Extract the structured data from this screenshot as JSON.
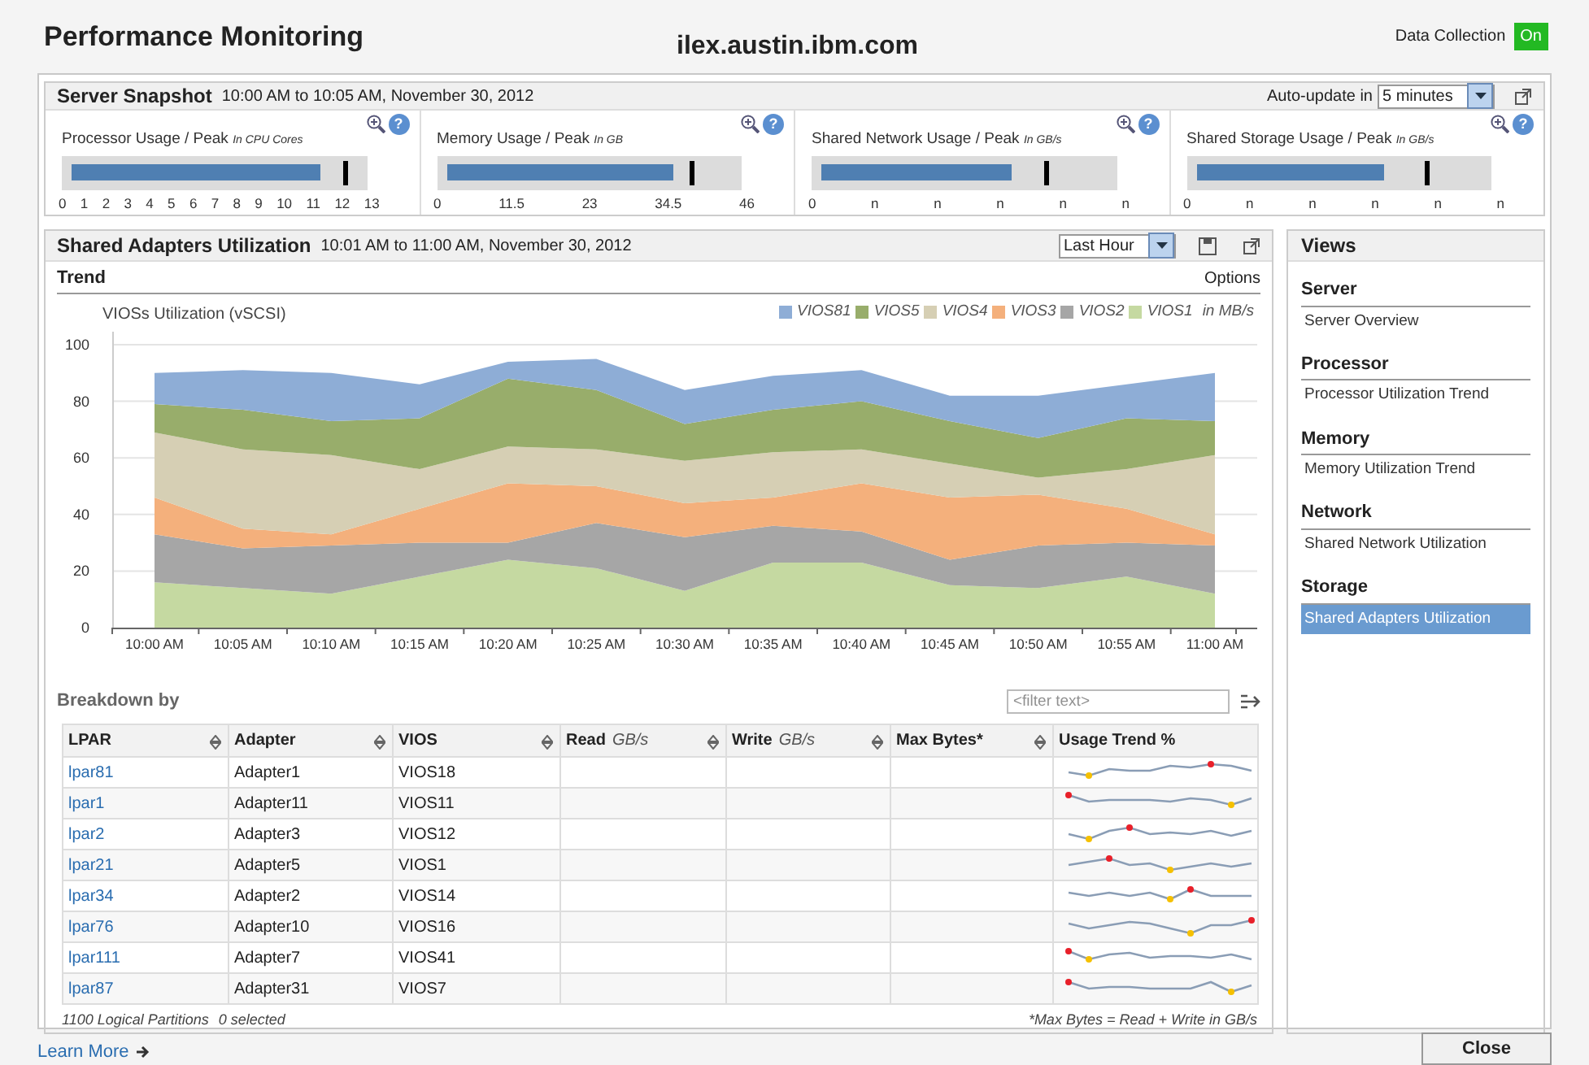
{
  "header": {
    "title": "Performance Monitoring",
    "host": "ilex.austin.ibm.com",
    "data_collection": {
      "label": "Data Collection",
      "value": "On",
      "on": true
    }
  },
  "server_snapshot": {
    "title": "Server Snapshot",
    "range": "10:00 AM to 10:05 AM, November 30, 2012",
    "auto_update": {
      "label": "Auto-update in",
      "value": "5 minutes"
    },
    "gauges": [
      {
        "label": "Processor Usage / Peak",
        "unit": "In CPU Cores",
        "help": "?",
        "level": 0.88,
        "peak": {
          "level": 0.92
        },
        "ticks": [
          "0",
          "1",
          "2",
          "3",
          "4",
          "5",
          "6",
          "7",
          "8",
          "9",
          "10",
          "11",
          "12",
          "13"
        ]
      },
      {
        "label": "Memory Usage / Peak",
        "unit": "In GB",
        "help": "?",
        "level": 0.81,
        "peak": {
          "level": 0.83
        },
        "ticks": [
          "0",
          "11.5",
          "23",
          "34.5",
          "46"
        ]
      },
      {
        "label": "Shared Network Usage / Peak",
        "unit": "In GB/s",
        "help": "?",
        "level": 0.69,
        "peak": {
          "level": 0.76
        },
        "ticks": [
          "0",
          "n",
          "n",
          "n",
          "n",
          "n"
        ]
      },
      {
        "label": "Shared Storage Usage / Peak",
        "unit": "In GB/s",
        "help": "?",
        "level": 0.68,
        "peak": {
          "level": 0.78
        },
        "ticks": [
          "0",
          "n",
          "n",
          "n",
          "n",
          "n"
        ]
      }
    ]
  },
  "adapters": {
    "title": "Shared Adapters Utilization",
    "range": "10:01 AM to 11:00 AM, November 30, 2012",
    "period": "Last Hour",
    "trend": {
      "title": "Trend",
      "options": "Options",
      "unit": "in MB/s",
      "chart_data": {
        "type": "area",
        "title": "VIOSs Utilization (vSCSI)",
        "stacked": true,
        "categories": [
          "10:00 AM",
          "10:05 AM",
          "10:10 AM",
          "10:15 AM",
          "10:20 AM",
          "10:25 AM",
          "10:30 AM",
          "10:35 AM",
          "10:40 AM",
          "10:45 AM",
          "10:50 AM",
          "10:55 AM",
          "11:00 AM"
        ],
        "ylim": [
          0,
          100
        ],
        "yticks": [
          0,
          20,
          40,
          60,
          80,
          100
        ],
        "grid": true,
        "legend": true,
        "series": [
          {
            "name": "VIOS81",
            "color": "#8eadd6",
            "values": [
              11,
              14,
              17,
              12,
              6,
              11,
              12,
              12,
              11,
              9,
              15,
              12,
              17
            ]
          },
          {
            "name": "VIOS5",
            "color": "#98ad6b",
            "values": [
              10,
              14,
              12,
              18,
              24,
              21,
              13,
              15,
              17,
              15,
              14,
              18,
              12
            ]
          },
          {
            "name": "VIOS4",
            "color": "#d6cfb4",
            "values": [
              23,
              28,
              28,
              14,
              13,
              13,
              15,
              16,
              12,
              12,
              6,
              14,
              28
            ]
          },
          {
            "name": "VIOS3",
            "color": "#f4b07c",
            "values": [
              13,
              7,
              4,
              12,
              21,
              13,
              12,
              10,
              17,
              22,
              18,
              12,
              4
            ]
          },
          {
            "name": "VIOS2",
            "color": "#a6a6a6",
            "values": [
              17,
              14,
              17,
              12,
              6,
              16,
              19,
              13,
              11,
              9,
              15,
              12,
              17
            ]
          },
          {
            "name": "VIOS1",
            "color": "#c5d9a1",
            "values": [
              16,
              14,
              12,
              18,
              24,
              21,
              13,
              23,
              23,
              15,
              14,
              18,
              12
            ]
          }
        ]
      }
    },
    "breakdown": {
      "title": "Breakdown by",
      "filter": {
        "placeholder": "<filter text>"
      },
      "columns": [
        {
          "label": "LPAR",
          "sortable": true
        },
        {
          "label": "Adapter",
          "sortable": true
        },
        {
          "label": "VIOS",
          "sortable": true
        },
        {
          "label": "Read",
          "unit": "GB/s",
          "sortable": true
        },
        {
          "label": "Write",
          "unit": "GB/s",
          "sortable": true
        },
        {
          "label": "Max Bytes*",
          "sortable": true
        },
        {
          "label": "Usage Trend %",
          "sortable": false
        }
      ],
      "rows": [
        {
          "lpar": "lpar81",
          "adapter": "Adapter1",
          "vios": "VIOS18"
        },
        {
          "lpar": "lpar1",
          "adapter": "Adapter11",
          "vios": "VIOS11"
        },
        {
          "lpar": "lpar2",
          "adapter": "Adapter3",
          "vios": "VIOS12"
        },
        {
          "lpar": "lpar21",
          "adapter": "Adapter5",
          "vios": "VIOS1"
        },
        {
          "lpar": "lpar34",
          "adapter": "Adapter2",
          "vios": "VIOS14"
        },
        {
          "lpar": "lpar76",
          "adapter": "Adapter10",
          "vios": "VIOS16"
        },
        {
          "lpar": "lpar111",
          "adapter": "Adapter7",
          "vios": "VIOS41"
        },
        {
          "lpar": "lpar87",
          "adapter": "Adapter31",
          "vios": "VIOS7"
        }
      ],
      "count": "1100 Logical Partitions",
      "selected_count": "0 selected",
      "footnote": "*Max Bytes = Read + Write in GB/s"
    }
  },
  "views": {
    "title": "Views",
    "groups": [
      {
        "title": "Server",
        "items": [
          {
            "label": "Server Overview",
            "selected": false
          }
        ]
      },
      {
        "title": "Processor",
        "items": [
          {
            "label": "Processor Utilization Trend",
            "selected": false
          }
        ]
      },
      {
        "title": "Memory",
        "items": [
          {
            "label": "Memory Utilization Trend",
            "selected": false
          }
        ]
      },
      {
        "title": "Network",
        "items": [
          {
            "label": "Shared Network Utilization",
            "selected": false
          }
        ]
      },
      {
        "title": "Storage",
        "items": [
          {
            "label": "Shared Adapters Utilization",
            "selected": true
          }
        ]
      }
    ]
  },
  "learn_more": "Learn More",
  "close": "Close"
}
